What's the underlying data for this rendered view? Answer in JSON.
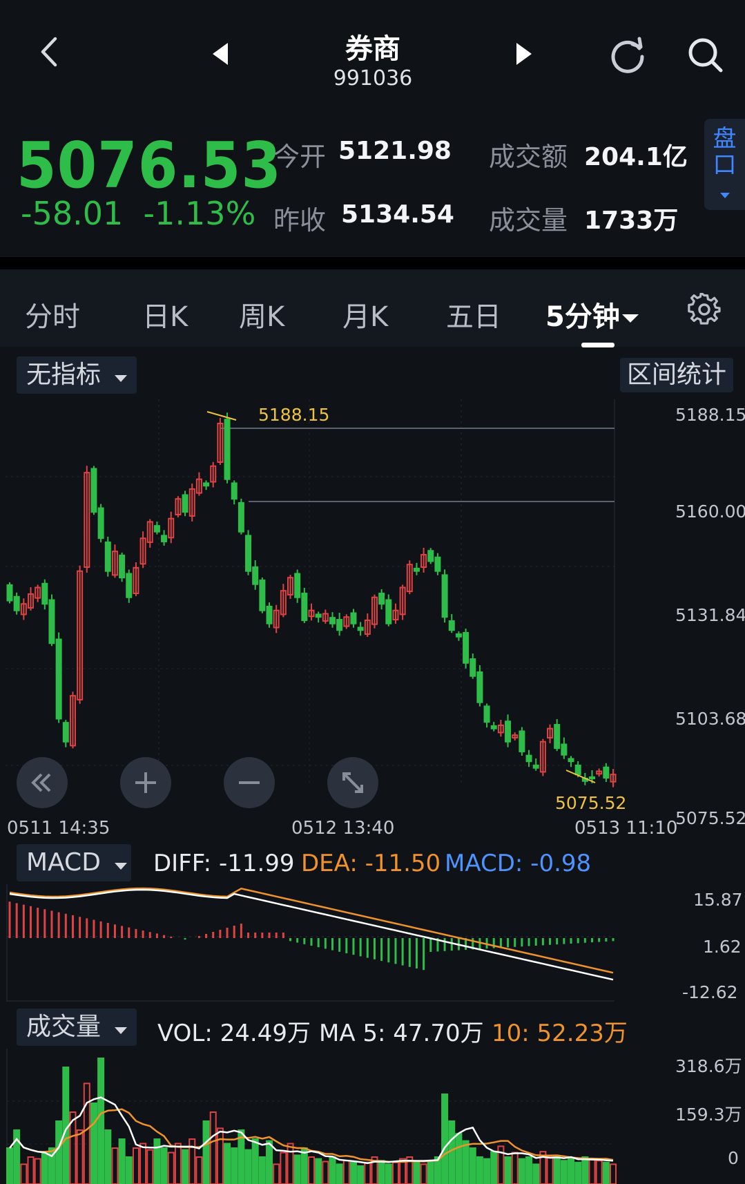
{
  "header": {
    "title": "券商",
    "code": "991036",
    "back_icon": "chevron-left-icon",
    "prev_icon": "triangle-left-icon",
    "next_icon": "triangle-right-icon",
    "refresh_icon": "refresh-icon",
    "search_icon": "search-icon"
  },
  "quote": {
    "price": "5076.53",
    "change": "-58.01",
    "change_pct": "-1.13%",
    "open_label": "今开",
    "open": "5121.98",
    "prev_close_label": "昨收",
    "prev_close": "5134.54",
    "turnover_label": "成交额",
    "turnover": "204.1亿",
    "volume_label": "成交量",
    "volume": "1733万",
    "pankou": "盘口",
    "up_color": "#e04343",
    "down_color": "#2fbd4a"
  },
  "tabs": [
    {
      "label": "分时"
    },
    {
      "label": "日K"
    },
    {
      "label": "周K"
    },
    {
      "label": "月K"
    },
    {
      "label": "五日"
    },
    {
      "label": "5分钟",
      "active": true
    }
  ],
  "settings_icon": "gear-icon",
  "indicator_select": "无指标",
  "range_stats": "区间统计",
  "kline": {
    "y_labels": [
      "5188.15",
      "5160.00",
      "5131.84",
      "5103.68",
      "5075.52"
    ],
    "high_label": "5188.15",
    "low_label": "5075.52",
    "x_labels": [
      "0511  14:35",
      "0512  13:40",
      "0513  11:10"
    ],
    "y_range": [
      5075.52,
      5188.15
    ]
  },
  "zoom_buttons": [
    "rewind-icon",
    "zoom-in-icon",
    "zoom-out-icon",
    "fullscreen-icon"
  ],
  "macd": {
    "select": "MACD",
    "diff": "DIFF: -11.99",
    "dea": "DEA: -11.50",
    "macd": "MACD: -0.98",
    "y_labels": [
      "15.87",
      "1.62",
      "-12.62"
    ]
  },
  "volume": {
    "select": "成交量",
    "vol": "VOL: 24.49万",
    "ma5": "MA 5: 47.70万",
    "ma10": "10: 52.23万",
    "y_labels": [
      "318.6万",
      "159.3万",
      "0"
    ]
  }
}
